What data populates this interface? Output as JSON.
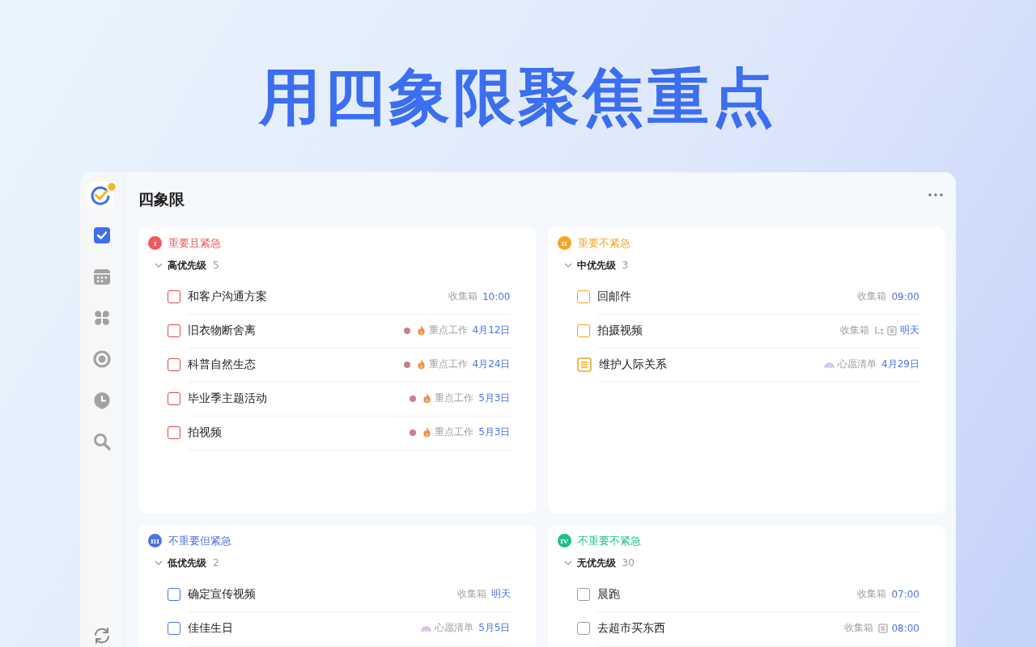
{
  "headline": "用四象限聚焦重点",
  "sidebar": {
    "items": [
      {
        "kind": "tasks",
        "selected": true
      },
      {
        "kind": "calendar",
        "selected": false
      },
      {
        "kind": "matrix",
        "selected": false
      },
      {
        "kind": "focus",
        "selected": false
      },
      {
        "kind": "habit",
        "selected": false
      },
      {
        "kind": "search",
        "selected": false
      }
    ]
  },
  "title": "四象限",
  "quadrants": [
    {
      "numeral": "I",
      "name": "重要且紧急",
      "color": "#f0585b",
      "group": {
        "label": "高优先级",
        "count": "5",
        "color": "#e0494c",
        "expanded": true,
        "tasks": [
          {
            "kind": "task",
            "title": "和客户沟通方案",
            "list": {
              "kind": "plain",
              "name": "收集箱"
            },
            "date": "10:00"
          },
          {
            "kind": "task",
            "title": "旧衣物断舍离",
            "color": "#c9838a",
            "list": {
              "kind": "fire",
              "name": "重点工作"
            },
            "date": "4月12日"
          },
          {
            "kind": "task",
            "title": "科普自然生态",
            "color": "#c9838a",
            "list": {
              "kind": "fire",
              "name": "重点工作"
            },
            "date": "4月24日"
          },
          {
            "kind": "task",
            "title": "毕业季主题活动",
            "color": "#c9838a",
            "list": {
              "kind": "fire",
              "name": "重点工作"
            },
            "date": "5月3日"
          },
          {
            "kind": "task",
            "title": "拍视频",
            "color": "#c9838a",
            "list": {
              "kind": "fire",
              "name": "重点工作"
            },
            "date": "5月3日"
          }
        ]
      }
    },
    {
      "numeral": "II",
      "name": "重要不紧急",
      "color": "#f5a623",
      "group": {
        "label": "中优先级",
        "count": "3",
        "color": "#f5a623",
        "expanded": true,
        "tasks": [
          {
            "kind": "task",
            "title": "回邮件",
            "list": {
              "kind": "plain",
              "name": "收集箱"
            },
            "date": "09:00"
          },
          {
            "kind": "task",
            "title": "拍摄视频",
            "list": {
              "kind": "plain",
              "name": "收集箱"
            },
            "subtasks": true,
            "note": true,
            "date": "明天"
          },
          {
            "kind": "note",
            "title": "维护人际关系",
            "list": {
              "kind": "rainbow",
              "name": "心愿清单"
            },
            "date": "4月29日"
          }
        ]
      }
    },
    {
      "numeral": "III",
      "name": "不重要但紧急",
      "color": "#4a72e6",
      "group": {
        "label": "低优先级",
        "count": "2",
        "color": "#4a72e6",
        "expanded": true,
        "tasks": [
          {
            "kind": "task",
            "title": "确定宣传视频",
            "list": {
              "kind": "plain",
              "name": "收集箱"
            },
            "date": "明天"
          },
          {
            "kind": "task",
            "title": "佳佳生日",
            "list": {
              "kind": "rainbow",
              "name": "心愿清单"
            },
            "date": "5月5日"
          }
        ]
      }
    },
    {
      "numeral": "IV",
      "name": "不重要不紧急",
      "color": "#1fbf8c",
      "group": {
        "label": "无优先级",
        "count": "30",
        "color": "#9a9a9a",
        "expanded": true,
        "tasks": [
          {
            "kind": "task",
            "title": "晨跑",
            "list": {
              "kind": "plain",
              "name": "收集箱"
            },
            "date": "07:00"
          },
          {
            "kind": "task",
            "title": "去超市买东西",
            "list": {
              "kind": "plain",
              "name": "收集箱"
            },
            "note": true,
            "date": "08:00"
          }
        ]
      }
    }
  ]
}
